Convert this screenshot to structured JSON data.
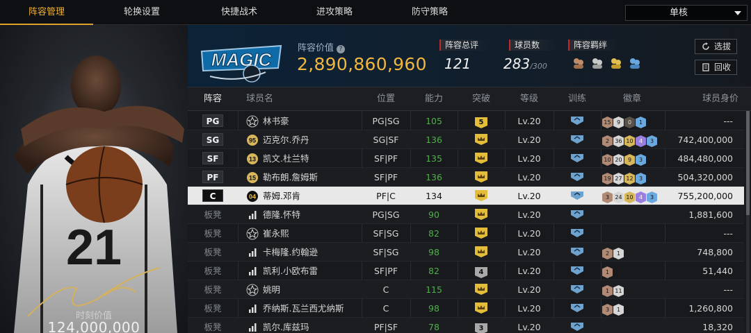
{
  "nav": {
    "tabs": [
      {
        "label": "阵容管理",
        "active": true
      },
      {
        "label": "轮换设置"
      },
      {
        "label": "快捷战术"
      },
      {
        "label": "进攻策略"
      },
      {
        "label": "防守策略"
      }
    ],
    "mode": "单核"
  },
  "player_card": {
    "jersey": "21",
    "value_caption": "时刻价值",
    "value": "124,000,000"
  },
  "team": {
    "logo_text": "MAGIC",
    "lineup_value_label": "阵容价值",
    "lineup_value": "2,890,860,960",
    "overall_label": "阵容总评",
    "overall": "121",
    "players_label": "球员数",
    "players_count": "283",
    "players_max": "/300",
    "bond_label": "阵容羁绊",
    "select_btn": "选拔",
    "recycle_btn": "回收"
  },
  "table": {
    "headers": [
      "阵容",
      "球员名",
      "位置",
      "能力",
      "突破",
      "等级",
      "训练",
      "徽章",
      "球员身价"
    ],
    "rows": [
      {
        "slot": "PG",
        "rank": "",
        "rank_type": "star",
        "name": "林书豪",
        "pos": "PG|SG",
        "ability": "105",
        "breakthrough": "5",
        "bt_type": "gold-num",
        "level": "Lv.20",
        "badges": [
          [
            "15",
            "b-bronze"
          ],
          [
            "9",
            "b-silver"
          ],
          [
            "0",
            "b-dark"
          ],
          [
            "1",
            "b-blue"
          ]
        ],
        "value": "---"
      },
      {
        "slot": "SG",
        "rank": "95",
        "rank_type": "gold",
        "name": "迈克尔.乔丹",
        "pos": "SG|SF",
        "ability": "136",
        "breakthrough": "",
        "bt_type": "crown",
        "level": "Lv.20",
        "badges": [
          [
            "2",
            "b-bronze"
          ],
          [
            "36",
            "b-silver"
          ],
          [
            "10",
            "b-gold"
          ],
          [
            "4",
            "b-purple"
          ],
          [
            "3",
            "b-blue"
          ]
        ],
        "value": "742,400,000"
      },
      {
        "slot": "SF",
        "rank": "13",
        "rank_type": "gold",
        "name": "凯文.杜兰特",
        "pos": "SF|PF",
        "ability": "135",
        "breakthrough": "",
        "bt_type": "crown",
        "level": "Lv.20",
        "badges": [
          [
            "10",
            "b-bronze"
          ],
          [
            "20",
            "b-silver"
          ],
          [
            "9",
            "b-gold"
          ],
          [
            "3",
            "b-blue"
          ]
        ],
        "value": "484,480,000"
      },
      {
        "slot": "PF",
        "rank": "15",
        "rank_type": "gold",
        "name": "勒布朗.詹姆斯",
        "pos": "SF|PF",
        "ability": "136",
        "breakthrough": "",
        "bt_type": "crown",
        "level": "Lv.20",
        "badges": [
          [
            "19",
            "b-bronze"
          ],
          [
            "27",
            "b-silver"
          ],
          [
            "12",
            "b-gold"
          ],
          [
            "3",
            "b-blue"
          ]
        ],
        "value": "504,320,000"
      },
      {
        "slot": "C",
        "rank": "04",
        "rank_type": "gold",
        "name": "蒂姆.邓肯",
        "pos": "PF|C",
        "ability": "134",
        "breakthrough": "",
        "bt_type": "crown",
        "level": "Lv.20",
        "badges": [
          [
            "3",
            "b-bronze"
          ],
          [
            "24",
            "b-silver"
          ],
          [
            "10",
            "b-gold"
          ],
          [
            "4",
            "b-purple"
          ],
          [
            "3",
            "b-blue"
          ]
        ],
        "value": "755,200,000",
        "selected": true
      },
      {
        "slot": "板凳",
        "rank": "",
        "rank_type": "bars",
        "name": "德隆.怀特",
        "pos": "PG|SG",
        "ability": "90",
        "breakthrough": "",
        "bt_type": "crown",
        "level": "Lv.20",
        "badges": [],
        "value": "1,881,600"
      },
      {
        "slot": "板凳",
        "rank": "",
        "rank_type": "star",
        "name": "崔永熙",
        "pos": "SF|SG",
        "ability": "82",
        "breakthrough": "",
        "bt_type": "crown",
        "level": "Lv.20",
        "badges": [],
        "value": "---"
      },
      {
        "slot": "板凳",
        "rank": "",
        "rank_type": "bars",
        "name": "卡梅隆.约翰逊",
        "pos": "SF|SG",
        "ability": "98",
        "breakthrough": "",
        "bt_type": "crown",
        "level": "Lv.20",
        "badges": [
          [
            "2",
            "b-bronze"
          ],
          [
            "1",
            "b-silver"
          ]
        ],
        "value": "748,800"
      },
      {
        "slot": "板凳",
        "rank": "",
        "rank_type": "bars",
        "name": "凯利.小欧布雷",
        "pos": "SF|PF",
        "ability": "82",
        "breakthrough": "4",
        "bt_type": "gray-num",
        "level": "Lv.20",
        "badges": [
          [
            "1",
            "b-bronze"
          ]
        ],
        "value": "51,440"
      },
      {
        "slot": "板凳",
        "rank": "",
        "rank_type": "star",
        "name": "姚明",
        "pos": "C",
        "ability": "115",
        "breakthrough": "",
        "bt_type": "crown",
        "level": "Lv.20",
        "badges": [
          [
            "1",
            "b-bronze"
          ],
          [
            "11",
            "b-silver"
          ]
        ],
        "value": "---"
      },
      {
        "slot": "板凳",
        "rank": "",
        "rank_type": "bars",
        "name": "乔纳斯.瓦兰西尤纳斯",
        "pos": "C",
        "ability": "98",
        "breakthrough": "",
        "bt_type": "crown",
        "level": "Lv.20",
        "badges": [
          [
            "3",
            "b-bronze"
          ],
          [
            "1",
            "b-silver"
          ]
        ],
        "value": "1,260,800"
      },
      {
        "slot": "板凳",
        "rank": "",
        "rank_type": "bars",
        "name": "凯尔.库兹玛",
        "pos": "PF|SF",
        "ability": "78",
        "breakthrough": "3",
        "bt_type": "gray-num",
        "level": "Lv.20",
        "badges": [],
        "value": "18,320"
      }
    ]
  },
  "colors": {
    "accent": "#f2b233",
    "ability": "#4fb04a",
    "header_blue": "#0c2237"
  }
}
